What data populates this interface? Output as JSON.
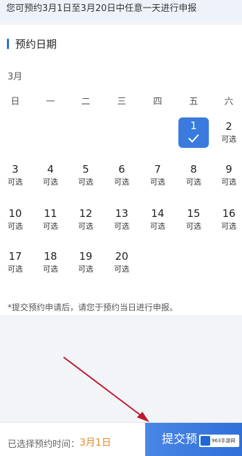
{
  "notice": "您可预约3月1日至3月20日中任意一天进行申报",
  "section_title": "预约日期",
  "month": "3月",
  "weekdays": [
    "日",
    "一",
    "二",
    "三",
    "四",
    "五",
    "六"
  ],
  "available_label": "可选",
  "days": [
    {
      "num": "1",
      "status": "selected"
    },
    {
      "num": "2",
      "status": "可选"
    },
    {
      "num": "3",
      "status": "可选"
    },
    {
      "num": "4",
      "status": "可选"
    },
    {
      "num": "5",
      "status": "可选"
    },
    {
      "num": "6",
      "status": "可选"
    },
    {
      "num": "7",
      "status": "可选"
    },
    {
      "num": "8",
      "status": "可选"
    },
    {
      "num": "9",
      "status": "可选"
    },
    {
      "num": "10",
      "status": "可选"
    },
    {
      "num": "11",
      "status": "可选"
    },
    {
      "num": "12",
      "status": "可选"
    },
    {
      "num": "13",
      "status": "可选"
    },
    {
      "num": "14",
      "status": "可选"
    },
    {
      "num": "15",
      "status": "可选"
    },
    {
      "num": "16",
      "status": "可选"
    },
    {
      "num": "17",
      "status": "可选"
    },
    {
      "num": "18",
      "status": "可选"
    },
    {
      "num": "19",
      "status": "可选"
    },
    {
      "num": "20",
      "status": "可选"
    }
  ],
  "hint": "*提交预约申请后，请您于预约当日进行申报。",
  "footer": {
    "selected_label": "已选择预约时间：",
    "selected_value": "3月1日",
    "submit_label": "提交预",
    "watermark": "963手游网"
  },
  "colors": {
    "accent": "#3a7bdd",
    "selected_value": "#e08a2a",
    "annotation_arrow": "#c0182b"
  },
  "icons": [
    "checkmark-icon",
    "red-arrow-annotation"
  ]
}
